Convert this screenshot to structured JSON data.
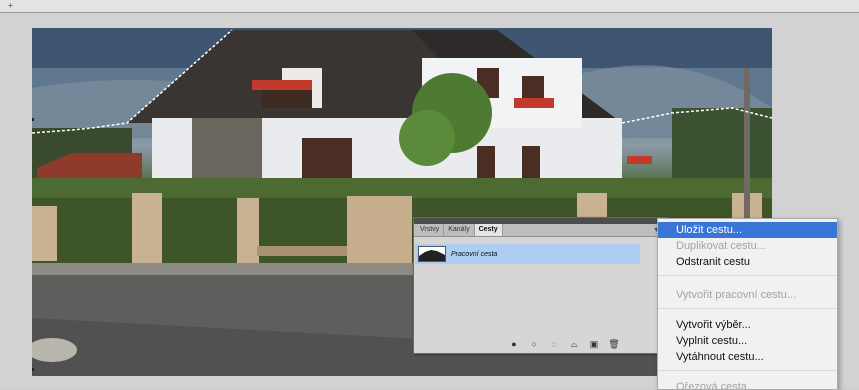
{
  "window": {
    "top_strip_mark": "+"
  },
  "panel": {
    "tabs": [
      {
        "label": "Vrstvy",
        "active": false
      },
      {
        "label": "Kanály",
        "active": false
      },
      {
        "label": "Cesty",
        "active": true
      }
    ],
    "collapse_glyph": "◂◂",
    "menu_glyph": "▾≡",
    "path_item": {
      "name": "Pracovní cesta"
    },
    "footer_icons": [
      "fill-path-icon",
      "stroke-path-icon",
      "load-selection-icon",
      "make-path-icon",
      "new-path-icon",
      "delete-path-icon"
    ]
  },
  "context_menu": {
    "items": [
      {
        "label": "Uložit cestu...",
        "state": "highlighted"
      },
      {
        "label": "Duplikovat cestu...",
        "state": "disabled"
      },
      {
        "label": "Odstranit cestu",
        "state": "enabled"
      },
      {
        "label": "Vytvořit pracovní cestu...",
        "state": "disabled"
      },
      {
        "label": "Vytvořit výběr...",
        "state": "enabled"
      },
      {
        "label": "Vyplnit cestu...",
        "state": "enabled"
      },
      {
        "label": "Vytáhnout cestu...",
        "state": "enabled"
      },
      {
        "label": "Ořezová cesta...",
        "state": "disabled"
      }
    ]
  },
  "colors": {
    "highlight": "#3875d7",
    "selected_row": "#aecdf2",
    "panel_bg": "#d6d6d6"
  }
}
